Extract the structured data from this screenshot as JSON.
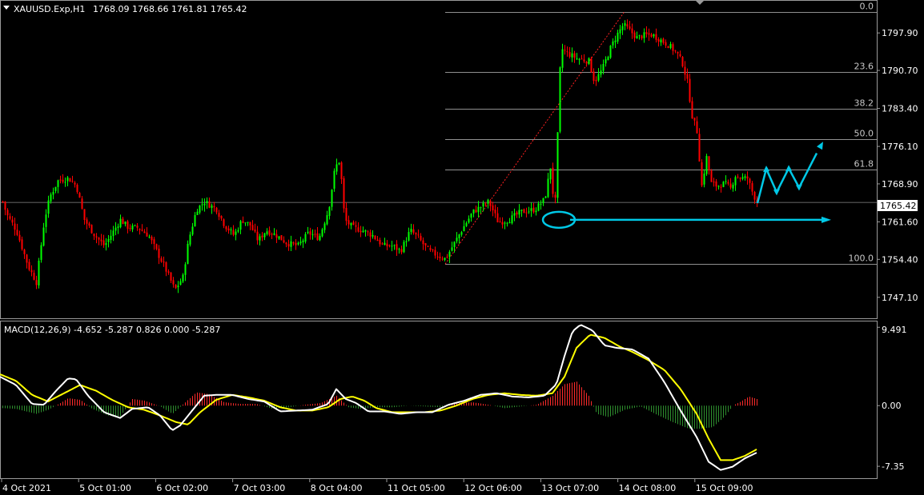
{
  "header": {
    "symbol": "XAUUSD.Exp,H1",
    "ohlc": "1768.09 1768.66 1761.81 1765.42"
  },
  "macd_header": "MACD(12,26,9) -4.652 -5.287 0.826 0.000 -5.287",
  "current_price_label": "1765.42",
  "colors": {
    "background": "#000000",
    "bull": "#00ff00",
    "bear": "#ff0000",
    "macd_main": "#ffffff",
    "macd_signal": "#ffff00",
    "annotation": "#00c8e6",
    "fib": "#c0c0c0"
  },
  "chart_data": [
    {
      "type": "candlestick",
      "symbol": "XAUUSD.Exp",
      "timeframe": "H1",
      "ylim": [
        1744.0,
        1803.0
      ],
      "y_ticks": [
        "1797.90",
        "1790.70",
        "1783.40",
        "1776.10",
        "1768.90",
        "1761.60",
        "1754.40",
        "1747.10"
      ],
      "x_ticks": [
        "4 Oct 2021",
        "5 Oct 01:00",
        "6 Oct 02:00",
        "7 Oct 03:00",
        "8 Oct 04:00",
        "11 Oct 05:00",
        "12 Oct 06:00",
        "13 Oct 07:00",
        "14 Oct 08:00",
        "15 Oct 09:00"
      ],
      "last_price": 1765.42,
      "close_path": [
        [
          0,
          1767.0
        ],
        [
          8,
          1763.0
        ],
        [
          20,
          1760.0
        ],
        [
          35,
          1753.0
        ],
        [
          45,
          1750.0
        ],
        [
          55,
          1762.0
        ],
        [
          62,
          1766.5
        ],
        [
          72,
          1769.5
        ],
        [
          85,
          1770.0
        ],
        [
          95,
          1768.5
        ],
        [
          105,
          1762.0
        ],
        [
          118,
          1759.0
        ],
        [
          130,
          1757.0
        ],
        [
          140,
          1759.5
        ],
        [
          150,
          1762.0
        ],
        [
          160,
          1760.5
        ],
        [
          172,
          1760.5
        ],
        [
          185,
          1759.0
        ],
        [
          195,
          1756.0
        ],
        [
          205,
          1753.0
        ],
        [
          218,
          1748.5
        ],
        [
          228,
          1751.0
        ],
        [
          235,
          1758.0
        ],
        [
          245,
          1764.0
        ],
        [
          255,
          1765.5
        ],
        [
          270,
          1764.0
        ],
        [
          280,
          1761.0
        ],
        [
          292,
          1759.0
        ],
        [
          302,
          1762.0
        ],
        [
          312,
          1761.0
        ],
        [
          322,
          1758.0
        ],
        [
          332,
          1760.0
        ],
        [
          345,
          1759.0
        ],
        [
          358,
          1757.5
        ],
        [
          372,
          1757.0
        ],
        [
          385,
          1759.5
        ],
        [
          398,
          1758.5
        ],
        [
          410,
          1764.0
        ],
        [
          418,
          1772.0
        ],
        [
          424,
          1773.5
        ],
        [
          430,
          1762.0
        ],
        [
          440,
          1760.5
        ],
        [
          452,
          1760.0
        ],
        [
          465,
          1759.0
        ],
        [
          478,
          1757.0
        ],
        [
          490,
          1757.0
        ],
        [
          500,
          1756.0
        ],
        [
          512,
          1760.0
        ],
        [
          522,
          1758.5
        ],
        [
          535,
          1756.0
        ],
        [
          548,
          1755.0
        ],
        [
          556,
          1754.5
        ],
        [
          565,
          1757.0
        ],
        [
          578,
          1760.5
        ],
        [
          590,
          1763.5
        ],
        [
          600,
          1764.5
        ],
        [
          610,
          1765.5
        ],
        [
          622,
          1761.5
        ],
        [
          635,
          1762.0
        ],
        [
          650,
          1763.5
        ],
        [
          668,
          1764.0
        ],
        [
          680,
          1766.0
        ],
        [
          688,
          1773.0
        ],
        [
          692,
          1761.5
        ],
        [
          700,
          1795.0
        ],
        [
          708,
          1794.0
        ],
        [
          720,
          1793.0
        ],
        [
          735,
          1792.5
        ],
        [
          742,
          1788.5
        ],
        [
          752,
          1791.0
        ],
        [
          762,
          1795.0
        ],
        [
          770,
          1797.5
        ],
        [
          778,
          1799.5
        ],
        [
          785,
          1798.5
        ],
        [
          795,
          1797.0
        ],
        [
          805,
          1797.5
        ],
        [
          815,
          1797.5
        ],
        [
          825,
          1796.5
        ],
        [
          835,
          1795.5
        ],
        [
          845,
          1794.0
        ],
        [
          852,
          1792.0
        ],
        [
          858,
          1788.5
        ],
        [
          864,
          1782.0
        ],
        [
          870,
          1779.0
        ],
        [
          876,
          1768.5
        ],
        [
          882,
          1774.0
        ],
        [
          888,
          1769.0
        ],
        [
          895,
          1768.5
        ],
        [
          905,
          1769.0
        ],
        [
          912,
          1768.0
        ],
        [
          918,
          1770.5
        ],
        [
          925,
          1770.0
        ],
        [
          933,
          1770.0
        ],
        [
          940,
          1767.0
        ],
        [
          945,
          1765.42
        ]
      ],
      "fibonacci": [
        {
          "level": "0.0",
          "price": 1802.0
        },
        {
          "level": "23.6",
          "price": 1790.4
        },
        {
          "level": "38.2",
          "price": 1783.3
        },
        {
          "level": "50.0",
          "price": 1777.5
        },
        {
          "level": "61.8",
          "price": 1771.7
        },
        {
          "level": "100.0",
          "price": 1753.5
        }
      ],
      "annotations": [
        {
          "type": "horizontal-arrow",
          "price": 1762.0,
          "label": ""
        },
        {
          "type": "ellipse",
          "price": 1762.0,
          "label": ""
        },
        {
          "type": "zigzag-arrow",
          "label": ""
        },
        {
          "type": "trend-line",
          "from_price": 1753.5,
          "to_price": 1802.0,
          "label": ""
        }
      ]
    },
    {
      "type": "macd",
      "params": [
        12,
        26,
        9
      ],
      "values": {
        "main": -4.652,
        "signal": -5.287,
        "histogram": 0.826
      },
      "ylim": [
        -8.6,
        10.0
      ],
      "y_ticks": [
        "9.491",
        "0.00",
        "-7.35"
      ],
      "main_path": [
        [
          0,
          3.5
        ],
        [
          20,
          2.5
        ],
        [
          40,
          0.2
        ],
        [
          55,
          0.1
        ],
        [
          70,
          1.8
        ],
        [
          85,
          3.3
        ],
        [
          95,
          3.2
        ],
        [
          110,
          1.2
        ],
        [
          130,
          -0.8
        ],
        [
          150,
          -1.5
        ],
        [
          165,
          -0.4
        ],
        [
          185,
          -0.2
        ],
        [
          200,
          -1.2
        ],
        [
          215,
          -3.0
        ],
        [
          225,
          -2.4
        ],
        [
          240,
          -0.6
        ],
        [
          255,
          1.2
        ],
        [
          270,
          1.3
        ],
        [
          290,
          1.3
        ],
        [
          310,
          0.8
        ],
        [
          330,
          0.5
        ],
        [
          350,
          -0.7
        ],
        [
          370,
          -0.6
        ],
        [
          390,
          -0.5
        ],
        [
          410,
          0.2
        ],
        [
          420,
          2.0
        ],
        [
          432,
          0.8
        ],
        [
          445,
          0.3
        ],
        [
          460,
          -0.7
        ],
        [
          480,
          -0.7
        ],
        [
          500,
          -1.0
        ],
        [
          520,
          -0.8
        ],
        [
          540,
          -0.8
        ],
        [
          560,
          0.1
        ],
        [
          580,
          0.6
        ],
        [
          600,
          1.3
        ],
        [
          620,
          1.5
        ],
        [
          640,
          1.1
        ],
        [
          660,
          1.0
        ],
        [
          680,
          1.2
        ],
        [
          695,
          2.6
        ],
        [
          705,
          6.0
        ],
        [
          715,
          9.0
        ],
        [
          725,
          9.8
        ],
        [
          740,
          9.1
        ],
        [
          755,
          7.3
        ],
        [
          770,
          7.0
        ],
        [
          790,
          6.8
        ],
        [
          810,
          5.7
        ],
        [
          830,
          2.8
        ],
        [
          850,
          -0.6
        ],
        [
          870,
          -3.8
        ],
        [
          885,
          -6.8
        ],
        [
          900,
          -7.8
        ],
        [
          915,
          -7.4
        ],
        [
          930,
          -6.4
        ],
        [
          945,
          -5.7
        ]
      ],
      "signal_path": [
        [
          0,
          3.8
        ],
        [
          20,
          3.0
        ],
        [
          40,
          1.3
        ],
        [
          60,
          0.5
        ],
        [
          80,
          1.5
        ],
        [
          100,
          2.5
        ],
        [
          120,
          1.8
        ],
        [
          140,
          0.7
        ],
        [
          160,
          -0.2
        ],
        [
          180,
          -0.5
        ],
        [
          200,
          -1.2
        ],
        [
          220,
          -2.0
        ],
        [
          235,
          -2.3
        ],
        [
          250,
          -0.8
        ],
        [
          270,
          0.7
        ],
        [
          290,
          1.3
        ],
        [
          310,
          1.0
        ],
        [
          330,
          0.6
        ],
        [
          350,
          -0.2
        ],
        [
          370,
          -0.6
        ],
        [
          390,
          -0.6
        ],
        [
          410,
          -0.2
        ],
        [
          425,
          0.8
        ],
        [
          440,
          1.1
        ],
        [
          455,
          0.6
        ],
        [
          470,
          -0.3
        ],
        [
          490,
          -0.8
        ],
        [
          510,
          -0.8
        ],
        [
          530,
          -0.8
        ],
        [
          550,
          -0.6
        ],
        [
          570,
          0.0
        ],
        [
          590,
          0.8
        ],
        [
          610,
          1.3
        ],
        [
          630,
          1.5
        ],
        [
          650,
          1.3
        ],
        [
          670,
          1.2
        ],
        [
          690,
          1.5
        ],
        [
          705,
          3.5
        ],
        [
          720,
          7.0
        ],
        [
          737,
          8.6
        ],
        [
          755,
          8.2
        ],
        [
          775,
          7.1
        ],
        [
          790,
          6.5
        ],
        [
          810,
          5.5
        ],
        [
          830,
          4.3
        ],
        [
          850,
          2.0
        ],
        [
          870,
          -1.0
        ],
        [
          885,
          -4.0
        ],
        [
          900,
          -6.6
        ],
        [
          915,
          -6.6
        ],
        [
          930,
          -6.1
        ],
        [
          945,
          -5.3
        ]
      ],
      "histogram_path": [
        [
          3,
          -0.3
        ],
        [
          20,
          -0.4
        ],
        [
          45,
          -1.0
        ],
        [
          60,
          -0.5
        ],
        [
          75,
          0.3
        ],
        [
          85,
          0.9
        ],
        [
          100,
          0.7
        ],
        [
          115,
          -0.4
        ],
        [
          135,
          -1.2
        ],
        [
          150,
          -1.3
        ],
        [
          165,
          0.8
        ],
        [
          180,
          0.6
        ],
        [
          200,
          -0.1
        ],
        [
          215,
          -1.0
        ],
        [
          230,
          0.3
        ],
        [
          245,
          1.6
        ],
        [
          260,
          1.4
        ],
        [
          280,
          0.4
        ],
        [
          300,
          0.2
        ],
        [
          320,
          0.2
        ],
        [
          340,
          -0.4
        ],
        [
          360,
          -0.2
        ],
        [
          380,
          0.1
        ],
        [
          400,
          0.3
        ],
        [
          420,
          1.2
        ],
        [
          435,
          -0.2
        ],
        [
          450,
          -0.4
        ],
        [
          470,
          -0.2
        ],
        [
          490,
          -0.2
        ],
        [
          510,
          0.0
        ],
        [
          530,
          -0.1
        ],
        [
          550,
          -0.2
        ],
        [
          570,
          0.3
        ],
        [
          590,
          0.4
        ],
        [
          610,
          0.1
        ],
        [
          630,
          -0.3
        ],
        [
          650,
          -0.1
        ],
        [
          670,
          0.1
        ],
        [
          690,
          1.2
        ],
        [
          705,
          2.6
        ],
        [
          720,
          2.9
        ],
        [
          735,
          1.2
        ],
        [
          745,
          -1.0
        ],
        [
          760,
          -1.4
        ],
        [
          780,
          -0.5
        ],
        [
          800,
          -0.1
        ],
        [
          820,
          -1.1
        ],
        [
          840,
          -2.0
        ],
        [
          860,
          -2.8
        ],
        [
          875,
          -2.8
        ],
        [
          890,
          -2.6
        ],
        [
          905,
          -1.3
        ],
        [
          915,
          0.0
        ],
        [
          925,
          0.5
        ],
        [
          935,
          1.1
        ],
        [
          945,
          0.8
        ]
      ]
    }
  ]
}
